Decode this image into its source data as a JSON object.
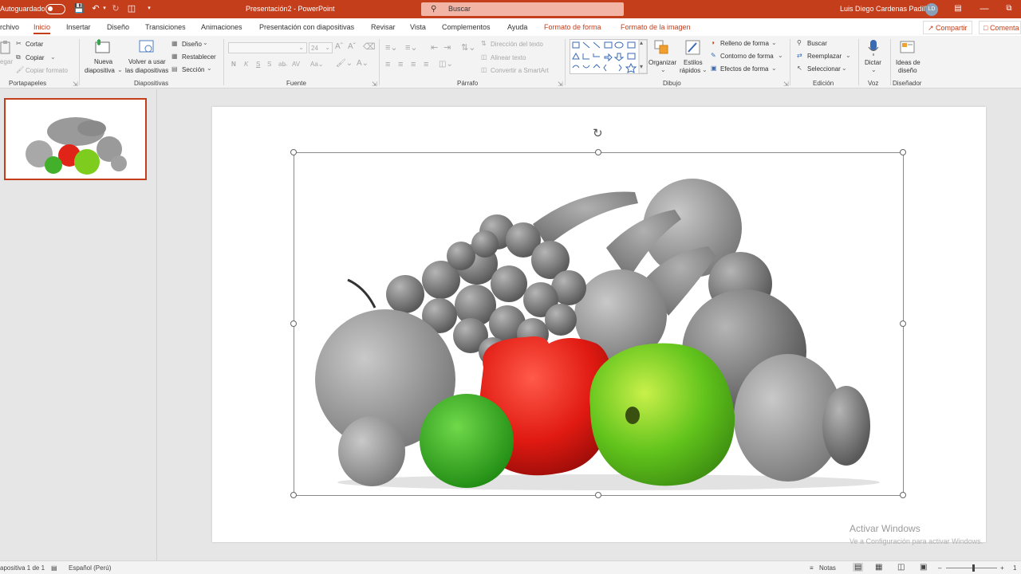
{
  "titlebar": {
    "autosave_label": "Autoguardado",
    "doc_title": "Presentación2  -  PowerPoint",
    "search_placeholder": "Buscar",
    "user_name": "Luis Diego Cardenas Padilla",
    "user_initials": "LD"
  },
  "tabs": [
    "rchivo",
    "Inicio",
    "Insertar",
    "Diseño",
    "Transiciones",
    "Animaciones",
    "Presentación con diapositivas",
    "Revisar",
    "Vista",
    "Complementos",
    "Ayuda",
    "Formato de forma",
    "Formato de la imagen"
  ],
  "share_label": "Compartir",
  "comments_label": "Comenta",
  "ribbon": {
    "portapapeles": {
      "pegar": "egar",
      "cortar": "Cortar",
      "copiar": "Copiar",
      "copiar_formato": "Copiar formato",
      "label": "Portapapeles"
    },
    "diapositivas": {
      "nueva": "Nueva",
      "nueva2": "diapositiva",
      "volver": "Volver a usar",
      "volver2": "las diapositivas",
      "diseno": "Diseño",
      "restablecer": "Restablecer",
      "seccion": "Sección",
      "label": "Diapositivas"
    },
    "fuente": {
      "size": "24",
      "bold": "N",
      "italic": "K",
      "underline": "S",
      "strike": "S",
      "label": "Fuente"
    },
    "parrafo": {
      "direccion": "Dirección del texto",
      "alinear": "Alinear texto",
      "smartart": "Convertir a SmartArt",
      "label": "Párrafo"
    },
    "dibujo": {
      "organizar": "Organizar",
      "estilos": "Estilos",
      "estilos2": "rápidos",
      "relleno": "Relleno de forma",
      "contorno": "Contorno de forma",
      "efectos": "Efectos de forma",
      "label": "Dibujo"
    },
    "edicion": {
      "buscar": "Buscar",
      "reemplazar": "Reemplazar",
      "seleccionar": "Seleccionar",
      "label": "Edición"
    },
    "voz": {
      "dictar": "Dictar",
      "label": "Voz"
    },
    "disenador": {
      "ideas": "Ideas de",
      "ideas2": "diseño",
      "label": "Diseñador"
    }
  },
  "status": {
    "slide_info": "apositiva 1 de 1",
    "language": "Español (Perú)",
    "notes": "Notas",
    "zoom_end": "1"
  },
  "watermark": {
    "line1": "Activar Windows",
    "line2": "Ve a Configuración para activar Windows."
  }
}
